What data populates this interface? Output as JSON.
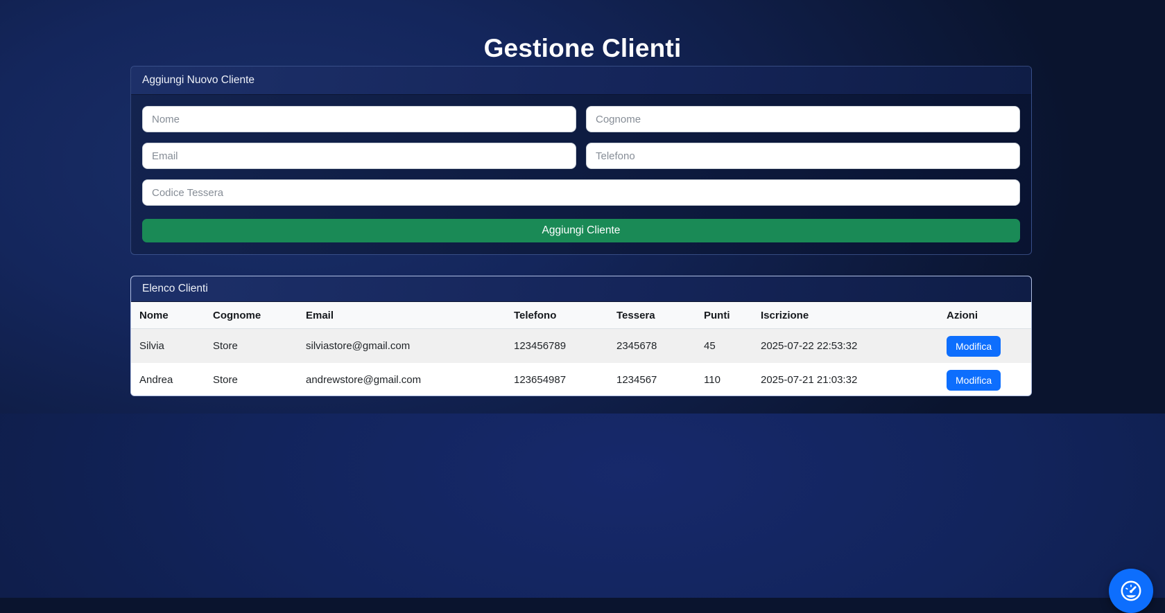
{
  "title": "Gestione Clienti",
  "colors": {
    "background_navy": "#14265c",
    "accent_green": "#1a8a56",
    "accent_blue": "#0d6efd",
    "table_header_bg": "#f8f9fa",
    "row_stripe": "#f0f0f0"
  },
  "add_card": {
    "header": "Aggiungi Nuovo Cliente",
    "inputs": {
      "nome": {
        "placeholder": "Nome",
        "value": ""
      },
      "cognome": {
        "placeholder": "Cognome",
        "value": ""
      },
      "email": {
        "placeholder": "Email",
        "value": ""
      },
      "telefono": {
        "placeholder": "Telefono",
        "value": ""
      },
      "codice_tessera": {
        "placeholder": "Codice Tessera",
        "value": ""
      }
    },
    "submit_label": "Aggiungi Cliente"
  },
  "list_card": {
    "header": "Elenco Clienti",
    "columns": [
      "Nome",
      "Cognome",
      "Email",
      "Telefono",
      "Tessera",
      "Punti",
      "Iscrizione",
      "Azioni"
    ],
    "rows": [
      {
        "nome": "Silvia",
        "cognome": "Store",
        "email": "silviastore@gmail.com",
        "telefono": "123456789",
        "tessera": "2345678",
        "punti": "45",
        "iscrizione": "2025-07-22 22:53:32",
        "action_label": "Modifica"
      },
      {
        "nome": "Andrea",
        "cognome": "Store",
        "email": "andrewstore@gmail.com",
        "telefono": "123654987",
        "tessera": "1234567",
        "punti": "110",
        "iscrizione": "2025-07-21 21:03:32",
        "action_label": "Modifica"
      }
    ]
  },
  "fab": {
    "icon": "speedometer-icon"
  }
}
